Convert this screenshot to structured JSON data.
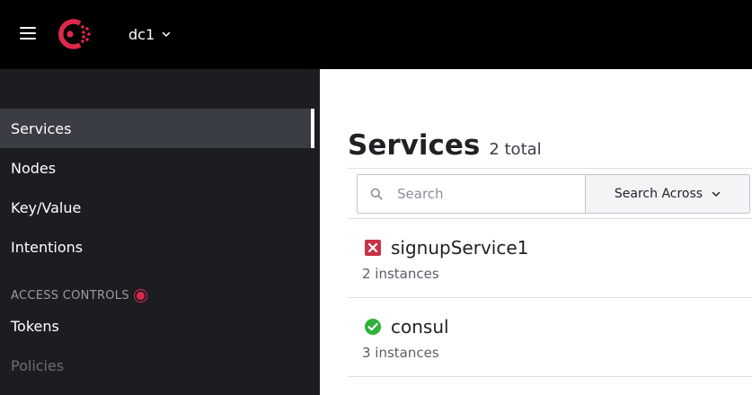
{
  "header": {
    "menu_icon": "hamburger-icon",
    "logo_icon": "consul-logo",
    "datacenter": "dc1",
    "datacenter_icon": "chevron-down-icon"
  },
  "sidebar": {
    "items": [
      {
        "label": "Services",
        "active": true
      },
      {
        "label": "Nodes"
      },
      {
        "label": "Key/Value"
      },
      {
        "label": "Intentions"
      }
    ],
    "section_label": "ACCESS CONTROLS",
    "section_items": [
      {
        "label": "Tokens"
      },
      {
        "label": "Policies",
        "disabled": true
      }
    ]
  },
  "main": {
    "title": "Services",
    "total": "2 total",
    "search": {
      "placeholder": "Search",
      "icon": "search-icon"
    },
    "search_across": "Search Across",
    "services": [
      {
        "name": "signupService1",
        "instances": "2 instances",
        "status": "critical",
        "status_icon": "x-square-icon"
      },
      {
        "name": "consul",
        "instances": "3 instances",
        "status": "passing",
        "status_icon": "check-circle-icon"
      }
    ]
  },
  "colors": {
    "brand": "#e0284d",
    "critical": "#c73445",
    "passing": "#2eb039",
    "sidebar_bg": "#1c1d21",
    "active_bg": "#3b3d45"
  }
}
